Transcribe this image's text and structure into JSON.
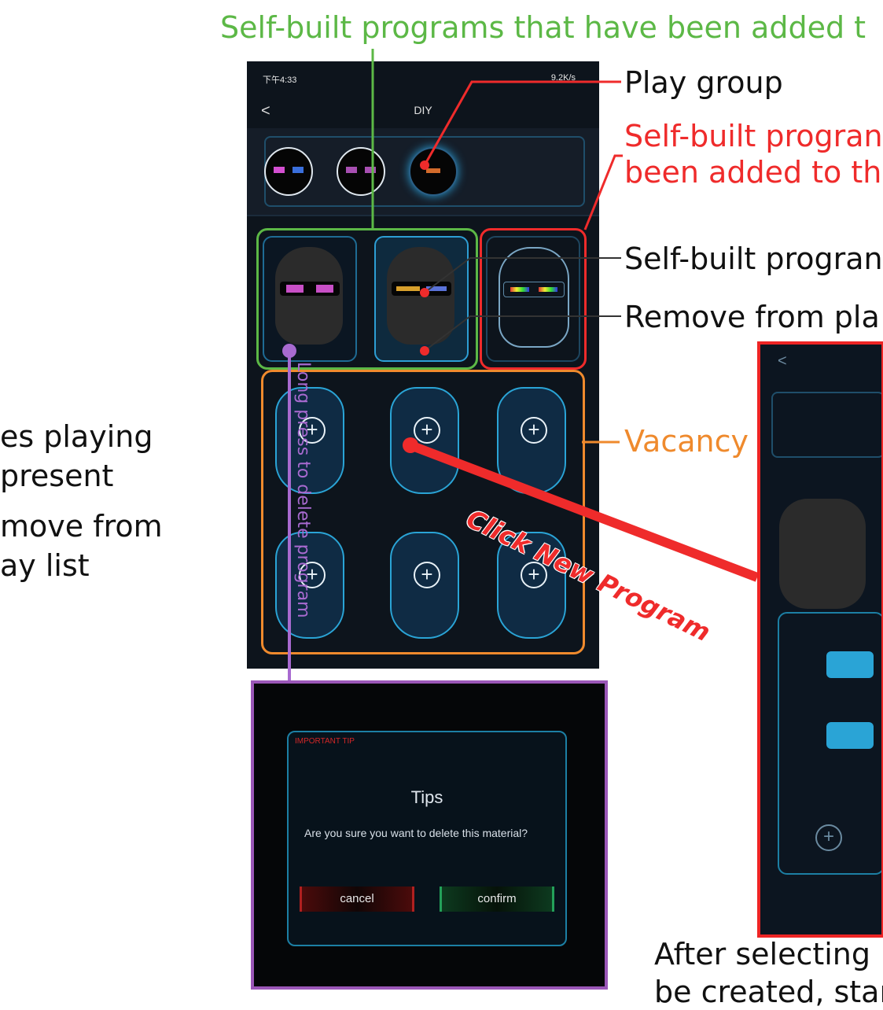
{
  "annotations": {
    "top_green": "Self-built programs that have been added t",
    "play_group": "Play group",
    "red_line1": "Self-built progran",
    "red_line2": "been added to th",
    "self_built": "Self-built progran",
    "remove_from": "Remove from pla",
    "vacancy": "Vacancy",
    "left_line1": "es playing",
    "left_line2": "present",
    "left_line3": "move from",
    "left_line4": "ay list",
    "long_press": "Long press to delete program",
    "click_new": "Click New Program",
    "bottom_line1": "After selecting",
    "bottom_line2": "be created, star"
  },
  "phone": {
    "time": "下午4:33",
    "network": "9.2K/s",
    "nav_title": "DIY"
  },
  "dialog": {
    "important_tip": "IMPORTANT TIP",
    "title": "Tips",
    "message": "Are you sure you want to delete this material?",
    "cancel": "cancel",
    "confirm": "confirm"
  },
  "colors": {
    "green": "#5cb846",
    "red": "#ef2b2b",
    "orange": "#ef8a2d",
    "purple": "#a86ad0"
  }
}
